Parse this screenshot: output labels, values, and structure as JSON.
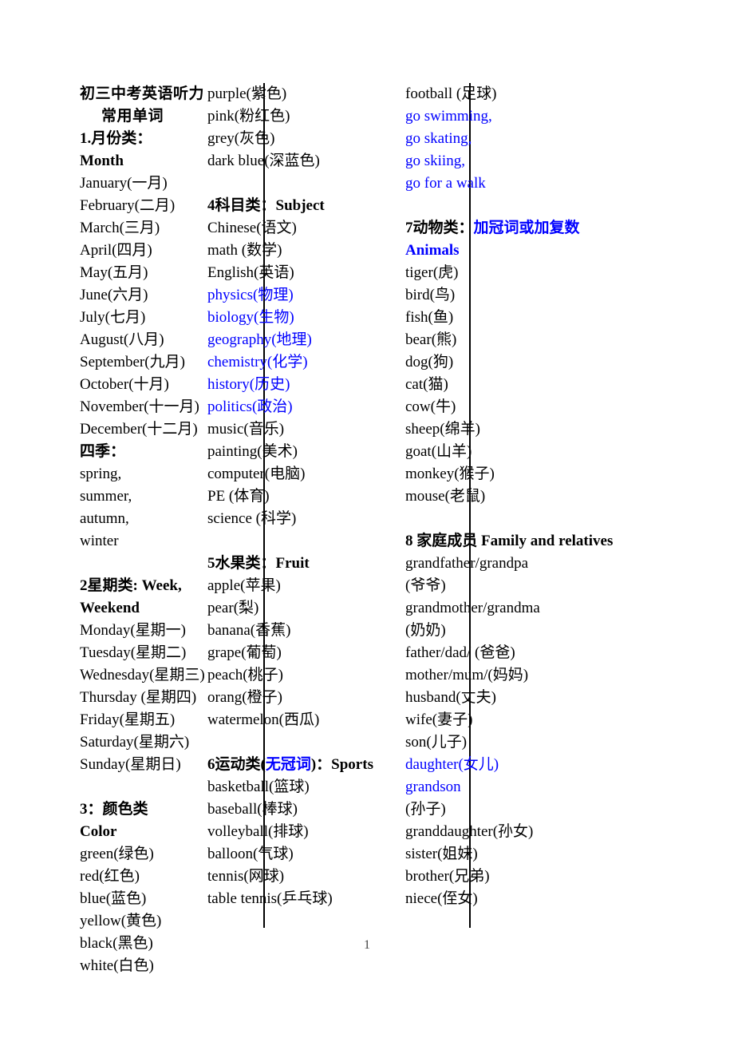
{
  "document": {
    "title_line1": "初三中考英语听力",
    "title_line2": "常用单词",
    "page_number": "1",
    "accent_blue": "#0000ff",
    "text_color": "#000000"
  },
  "columns": [
    {
      "id": "column-1",
      "blocks": [
        {
          "type": "heading",
          "text": "1.月份类：Month",
          "color": "#000000"
        },
        {
          "type": "entry",
          "text": "January(一月)",
          "color": "#000000"
        },
        {
          "type": "entry",
          "text": "February(二月)",
          "color": "#000000"
        },
        {
          "type": "entry",
          "text": "March(三月)",
          "color": "#000000"
        },
        {
          "type": "entry",
          "text": "April(四月)",
          "color": "#000000"
        },
        {
          "type": "entry",
          "text": "May(五月)",
          "color": "#000000"
        },
        {
          "type": "entry",
          "text": "June(六月)",
          "color": "#000000"
        },
        {
          "type": "entry",
          "text": "July(七月)",
          "color": "#000000"
        },
        {
          "type": "entry",
          "text": "August(八月)",
          "color": "#000000"
        },
        {
          "type": "entry",
          "text": "September(九月)",
          "color": "#000000"
        },
        {
          "type": "entry",
          "text": "October(十月)",
          "color": "#000000"
        },
        {
          "type": "entry",
          "text": "November(十一月)",
          "color": "#000000"
        },
        {
          "type": "entry",
          "text": "December(十二月)",
          "color": "#000000"
        },
        {
          "type": "subheading",
          "text": "四季：",
          "color": "#000000"
        },
        {
          "type": "entry",
          "text": "spring,",
          "color": "#000000"
        },
        {
          "type": "entry",
          "text": "summer,",
          "color": "#000000"
        },
        {
          "type": "entry",
          "text": "autumn,",
          "color": "#000000"
        },
        {
          "type": "entry",
          "text": "winter",
          "color": "#000000"
        },
        {
          "type": "spacer"
        },
        {
          "type": "heading",
          "text": "2星期类: Week, Weekend",
          "color": "#000000"
        },
        {
          "type": "entry",
          "text": "Monday(星期一)",
          "color": "#000000"
        },
        {
          "type": "entry",
          "text": "Tuesday(星期二)",
          "color": "#000000"
        },
        {
          "type": "entry",
          "text": "Wednesday(星期三)",
          "color": "#000000"
        },
        {
          "type": "entry",
          "text": "Thursday (星期四)",
          "color": "#000000"
        },
        {
          "type": "entry",
          "text": "Friday(星期五)",
          "color": "#000000"
        },
        {
          "type": "entry",
          "text": "Saturday(星期六)",
          "color": "#000000"
        },
        {
          "type": "entry",
          "text": "Sunday(星期日)",
          "color": "#000000"
        },
        {
          "type": "spacer"
        },
        {
          "type": "heading",
          "text": "3：颜色类 Color",
          "color": "#000000"
        },
        {
          "type": "entry",
          "text": "green(绿色)",
          "color": "#000000"
        },
        {
          "type": "entry",
          "text": "red(红色)",
          "color": "#000000"
        },
        {
          "type": "entry",
          "text": "blue(蓝色)",
          "color": "#000000"
        },
        {
          "type": "entry",
          "text": "yellow(黄色)",
          "color": "#000000"
        },
        {
          "type": "entry",
          "text": "black(黑色)",
          "color": "#000000"
        },
        {
          "type": "entry",
          "text": "white(白色)",
          "color": "#000000"
        }
      ]
    },
    {
      "id": "column-2",
      "blocks": [
        {
          "type": "entry",
          "text": "purple(紫色)",
          "color": "#000000"
        },
        {
          "type": "entry",
          "text": "pink(粉红色)",
          "color": "#000000"
        },
        {
          "type": "entry",
          "text": "grey(灰色)",
          "color": "#000000"
        },
        {
          "type": "entry",
          "text": "dark blue(深蓝色)",
          "color": "#000000"
        },
        {
          "type": "spacer"
        },
        {
          "type": "heading",
          "text": "4科目类：Subject",
          "color": "#000000"
        },
        {
          "type": "entry",
          "text": "Chinese(语文)",
          "color": "#000000"
        },
        {
          "type": "entry",
          "text": "math (数学)",
          "color": "#000000"
        },
        {
          "type": "entry",
          "text": "English(英语)",
          "color": "#000000"
        },
        {
          "type": "entry",
          "text": "physics(物理)",
          "color": "#0000ff"
        },
        {
          "type": "entry",
          "text": "biology(生物)",
          "color": "#0000ff"
        },
        {
          "type": "entry",
          "text": "geography(地理)",
          "color": "#0000ff"
        },
        {
          "type": "entry",
          "text": "chemistry(化学)",
          "color": "#0000ff"
        },
        {
          "type": "entry",
          "text": "history(历史)",
          "color": "#0000ff"
        },
        {
          "type": "entry",
          "text": "politics(政治)",
          "color": "#0000ff"
        },
        {
          "type": "entry",
          "text": "music(音乐)",
          "color": "#000000"
        },
        {
          "type": "entry",
          "text": "painting(美术)",
          "color": "#000000"
        },
        {
          "type": "entry",
          "text": "computer(电脑)",
          "color": "#000000"
        },
        {
          "type": "entry",
          "text": "PE (体育)",
          "color": "#000000"
        },
        {
          "type": "entry",
          "text": "science (科学)",
          "color": "#000000"
        },
        {
          "type": "spacer"
        },
        {
          "type": "heading",
          "text": "5水果类：Fruit",
          "color": "#000000"
        },
        {
          "type": "entry",
          "text": "apple(苹果)",
          "color": "#000000"
        },
        {
          "type": "entry",
          "text": "pear(梨)",
          "color": "#000000"
        },
        {
          "type": "entry",
          "text": "banana(香蕉)",
          "color": "#000000"
        },
        {
          "type": "entry",
          "text": "grape(葡萄)",
          "color": "#000000"
        },
        {
          "type": "entry",
          "text": "peach(桃子)",
          "color": "#000000"
        },
        {
          "type": "entry",
          "text": "orang(橙子)",
          "color": "#000000"
        },
        {
          "type": "entry",
          "text": "watermelon(西瓜)",
          "color": "#000000"
        },
        {
          "type": "spacer"
        },
        {
          "type": "heading-mixed",
          "parts": [
            {
              "text": "6运动类(",
              "color": "#000000"
            },
            {
              "text": "无冠词",
              "color": "#0000ff"
            },
            {
              "text": ")：Sports",
              "color": "#000000"
            }
          ]
        },
        {
          "type": "entry",
          "text": "basketball(篮球)",
          "color": "#000000"
        },
        {
          "type": "entry",
          "text": "baseball(棒球)",
          "color": "#000000"
        },
        {
          "type": "entry",
          "text": "volleyball(排球)",
          "color": "#000000"
        },
        {
          "type": "entry",
          "text": "balloon(气球)",
          "color": "#000000"
        },
        {
          "type": "entry",
          "text": "tennis(网球)",
          "color": "#000000"
        },
        {
          "type": "entry",
          "text": "table tennis(乒乓球)",
          "color": "#000000"
        }
      ]
    },
    {
      "id": "column-3",
      "blocks": [
        {
          "type": "entry",
          "text": "football (足球)",
          "color": "#000000"
        },
        {
          "type": "entry",
          "text": "go swimming,",
          "color": "#0000ff"
        },
        {
          "type": "entry",
          "text": "go skating,",
          "color": "#0000ff"
        },
        {
          "type": "entry",
          "text": "go skiing,",
          "color": "#0000ff"
        },
        {
          "type": "entry",
          "text": "go for a walk",
          "color": "#0000ff"
        },
        {
          "type": "spacer"
        },
        {
          "type": "heading-mixed",
          "parts": [
            {
              "text": "7动物类：",
              "color": "#000000"
            },
            {
              "text": "加冠词或加复数  Animals",
              "color": "#0000ff"
            }
          ]
        },
        {
          "type": "entry",
          "text": "tiger(虎)",
          "color": "#000000"
        },
        {
          "type": "entry",
          "text": "bird(鸟)",
          "color": "#000000"
        },
        {
          "type": "entry",
          "text": "fish(鱼)",
          "color": "#000000"
        },
        {
          "type": "entry",
          "text": "bear(熊)",
          "color": "#000000"
        },
        {
          "type": "entry",
          "text": "dog(狗)",
          "color": "#000000"
        },
        {
          "type": "entry",
          "text": "cat(猫)",
          "color": "#000000"
        },
        {
          "type": "entry",
          "text": "cow(牛)",
          "color": "#000000"
        },
        {
          "type": "entry",
          "text": "sheep(绵羊)",
          "color": "#000000"
        },
        {
          "type": "entry",
          "text": "goat(山羊)",
          "color": "#000000"
        },
        {
          "type": "entry",
          "text": "monkey(猴子)",
          "color": "#000000"
        },
        {
          "type": "entry",
          "text": "mouse(老鼠)",
          "color": "#000000"
        },
        {
          "type": "spacer"
        },
        {
          "type": "heading",
          "text": "8 家庭成员 Family and relatives",
          "color": "#000000"
        },
        {
          "type": "entry",
          "text": "grandfather/grandpa",
          "color": "#000000"
        },
        {
          "type": "entry",
          "text": "(爷爷)",
          "color": "#000000"
        },
        {
          "type": "entry",
          "text": "grandmother/grandma",
          "color": "#000000"
        },
        {
          "type": "entry",
          "text": "(奶奶)",
          "color": "#000000"
        },
        {
          "type": "entry",
          "text": "father/dad/ (爸爸)",
          "color": "#000000"
        },
        {
          "type": "entry",
          "text": "mother/mum/(妈妈)",
          "color": "#000000"
        },
        {
          "type": "entry",
          "text": "husband(丈夫)",
          "color": "#000000"
        },
        {
          "type": "entry",
          "text": "wife(妻子)",
          "color": "#000000"
        },
        {
          "type": "entry",
          "text": "son(儿子)",
          "color": "#000000"
        },
        {
          "type": "entry",
          "text": "daughter(女儿)",
          "color": "#0000ff"
        },
        {
          "type": "entry",
          "text": "grandson",
          "color": "#0000ff"
        },
        {
          "type": "entry",
          "text": "(孙子)",
          "color": "#000000"
        },
        {
          "type": "entry",
          "text": "granddaughter(孙女)",
          "color": "#000000"
        },
        {
          "type": "entry",
          "text": "sister(姐妹)",
          "color": "#000000"
        },
        {
          "type": "entry",
          "text": "brother(兄弟)",
          "color": "#000000"
        },
        {
          "type": "entry",
          "text": "niece(侄女)",
          "color": "#000000"
        }
      ]
    }
  ]
}
